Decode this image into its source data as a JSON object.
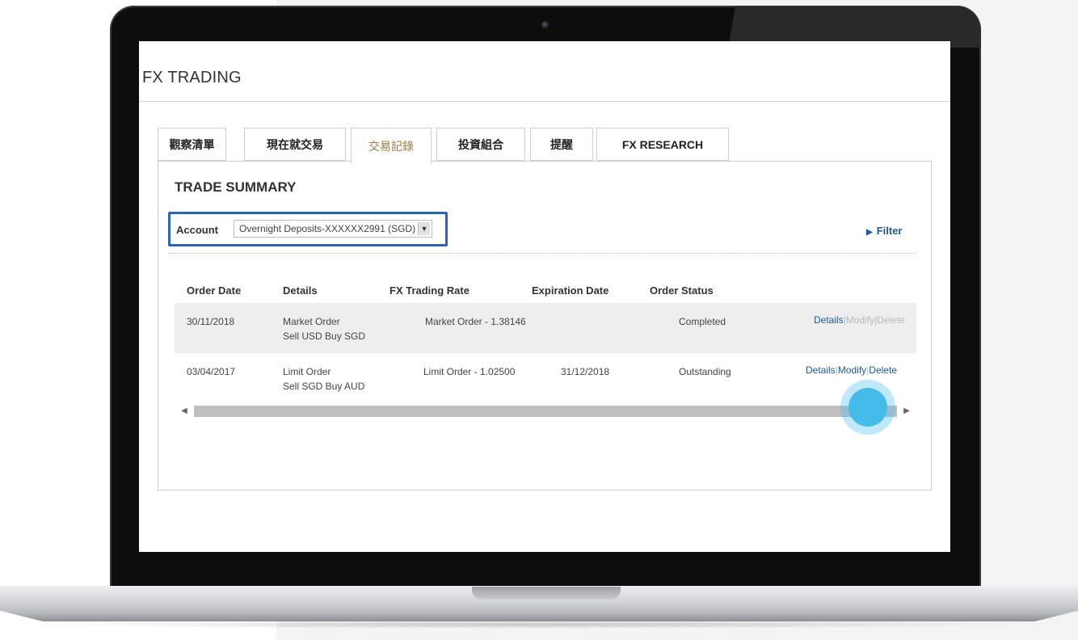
{
  "app": {
    "title": "FX TRADING"
  },
  "tabs": [
    {
      "label": "觀察清單"
    },
    {
      "label": "現在就交易"
    },
    {
      "label": "交易記錄"
    },
    {
      "label": "投資組合"
    },
    {
      "label": "提醒"
    },
    {
      "label": "FX RESEARCH"
    }
  ],
  "active_tab": "交易記錄",
  "summary": {
    "title": "TRADE SUMMARY",
    "account_label": "Account",
    "account_value": "Overnight Deposits-XXXXXX2991 (SGD)",
    "filter_label": "Filter"
  },
  "table": {
    "headers": [
      "Order Date",
      "Details",
      "FX Trading Rate",
      "Expiration Date",
      "Order Status"
    ],
    "rows": [
      {
        "date": "30/11/2018",
        "type": "Market Order",
        "pair": "Sell USD Buy SGD",
        "rate": "Market Order - 1.38146",
        "expiration": "",
        "status": "Completed",
        "actions": {
          "details": "Details",
          "modify": "Modify",
          "delete": "Delete"
        }
      },
      {
        "date": "03/04/2017",
        "type": "Limit Order",
        "pair": "Sell SGD Buy AUD",
        "rate": "Limit Order - 1.02500",
        "expiration": "31/12/2018",
        "status": "Outstanding",
        "actions": {
          "details": "Details",
          "modify": "Modify",
          "delete": "Delete"
        }
      }
    ]
  },
  "colors": {
    "accent_blue": "#2e64b8",
    "link_blue": "#1e5a99",
    "active_tab_text": "#a27a3e",
    "touch_indicator": "#45bbe9"
  },
  "icons": {
    "filter": "triangle-right-icon",
    "select": "triangle-down-icon",
    "scroll_left": "triangle-left-icon",
    "scroll_right": "triangle-right-icon"
  }
}
